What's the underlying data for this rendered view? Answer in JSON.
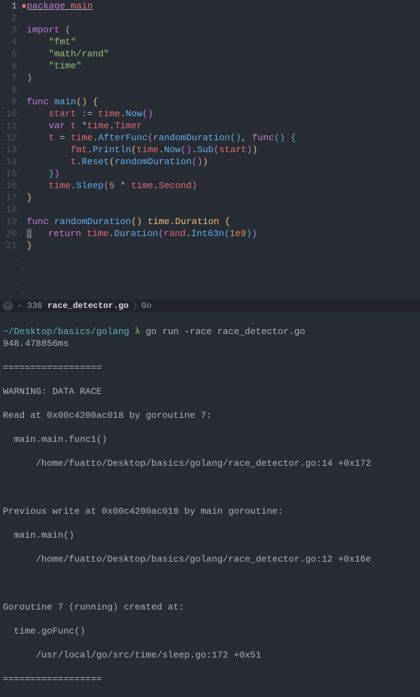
{
  "editor": {
    "lines": [
      {
        "n": "1",
        "active": true
      },
      {
        "n": "2"
      },
      {
        "n": "3"
      },
      {
        "n": "4"
      },
      {
        "n": "5"
      },
      {
        "n": "6"
      },
      {
        "n": "7"
      },
      {
        "n": "8"
      },
      {
        "n": "9"
      },
      {
        "n": "10"
      },
      {
        "n": "11"
      },
      {
        "n": "12"
      },
      {
        "n": "13"
      },
      {
        "n": "14"
      },
      {
        "n": "15"
      },
      {
        "n": "16"
      },
      {
        "n": "17"
      },
      {
        "n": "18"
      },
      {
        "n": "19"
      },
      {
        "n": "20"
      },
      {
        "n": "21"
      }
    ],
    "tokens": {
      "package": "package",
      "main": "main",
      "import": "import",
      "lparen": "(",
      "fmt_str": "\"fmt\"",
      "mathrand_str": "\"math/rand\"",
      "time_str": "\"time\"",
      "rparen": ")",
      "func": "func",
      "main_fn": "main",
      "lbrace": "{",
      "rbrace": "}",
      "start": "start",
      "assign": " := ",
      "time_id": "time",
      "dot": ".",
      "Now": "Now",
      "pp": "()",
      "var": "var",
      "t": "t",
      "star": " *",
      "Timer": "Timer",
      "eq": " = ",
      "AfterFunc": "AfterFunc",
      "randomDuration": "randomDuration",
      "comma": ", ",
      "func_kw": "func",
      "empty_pp": "()",
      "space": " ",
      "fmt_id": "fmt",
      "Println": "Println",
      "Sub": "Sub",
      "Reset": "Reset",
      "Sleep": "Sleep",
      "five": "5",
      "mul": " * ",
      "Second": "Second",
      "randomDuration_fn": "randomDuration",
      "Duration": "Duration",
      "return": "return",
      "rand_id": "rand",
      "Int63n": "Int63n",
      "one_e9": "1e9",
      "cursor": "▯"
    }
  },
  "status": {
    "icon": "✕",
    "dash": "-",
    "lineno": "336",
    "file": "race_detector.go",
    "lang": "Go"
  },
  "terminal": {
    "path": "~/Desktop/basics/golang",
    "prompt": "λ",
    "cmd": "go run -race race_detector.go",
    "out1": "948.478856ms",
    "sep": "==================",
    "warn": "WARNING: DATA RACE",
    "read": "Read at 0x00c4200ac018 by goroutine 7:",
    "func1": "  main.main.func1()",
    "loc1": "      /home/fuatto/Desktop/basics/golang/race_detector.go:14 +0x172",
    "prev": "Previous write at 0x00c4200ac018 by main goroutine:",
    "func2": "  main.main()",
    "loc2": "      /home/fuatto/Desktop/basics/golang/race_detector.go:12 +0x16e",
    "gor": "Goroutine 7 (running) created at:",
    "func3": "  time.goFunc()",
    "loc3": "      /usr/local/go/src/time/sleep.go:172 +0x51"
  },
  "tilde": "~"
}
